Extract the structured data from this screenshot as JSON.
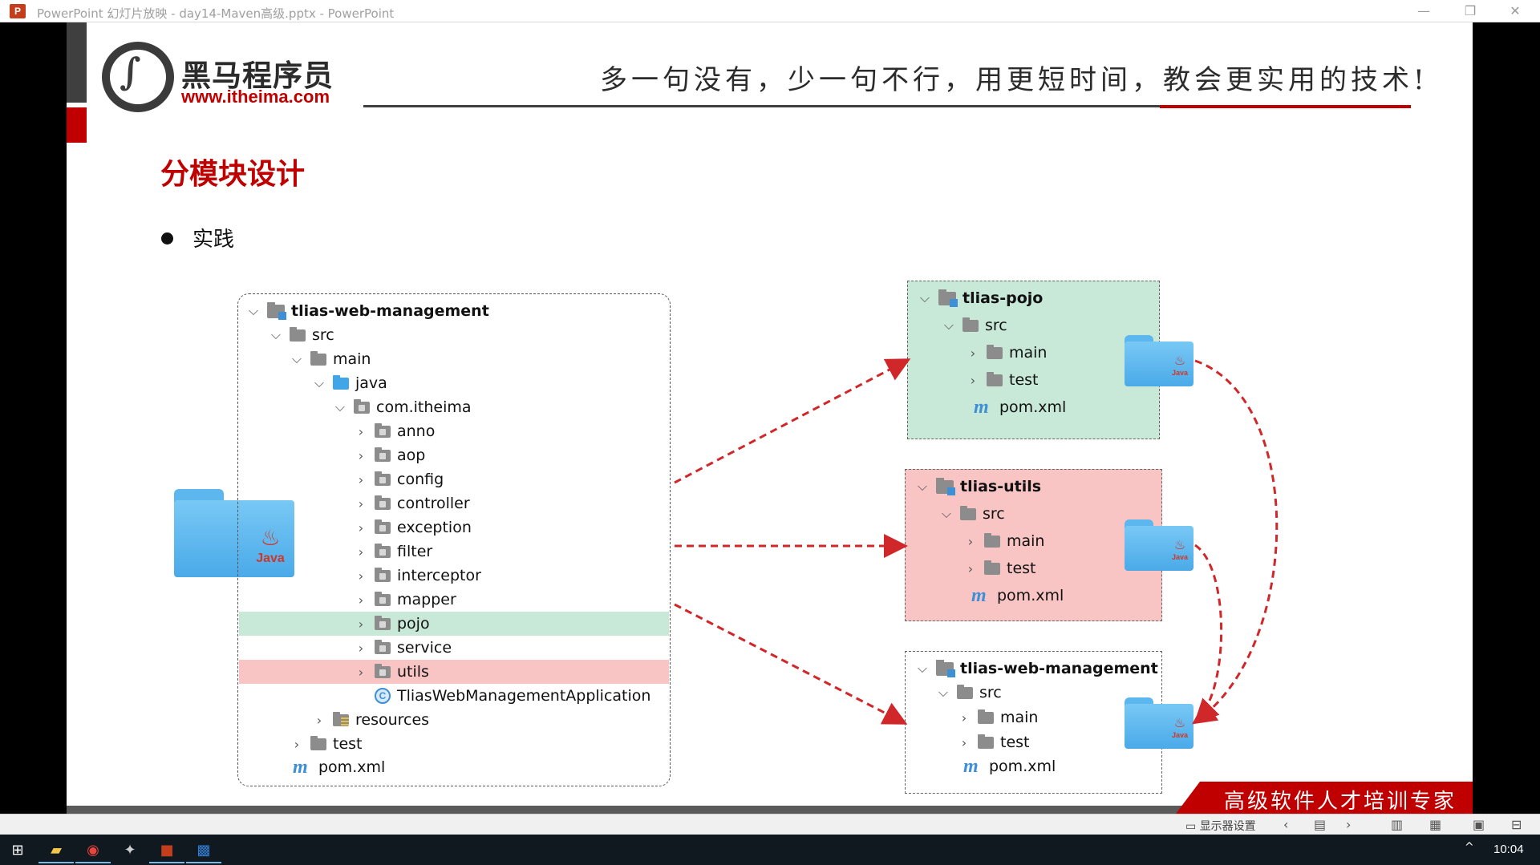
{
  "window": {
    "title": "PowerPoint 幻灯片放映  -  day14-Maven高级.pptx  -  PowerPoint",
    "app_logo": "P",
    "minimize": "—",
    "restore": "❐",
    "close": "✕"
  },
  "slide": {
    "brand_name": "黑马程序员",
    "brand_url": "www.itheima.com",
    "slogan": "多一句没有，少一句不行，用更短时间，教会更实用的技术!",
    "heading": "分模块设计",
    "bullet": "实践",
    "java_folder_label": "Java",
    "banner_text": "高级软件人才培训专家"
  },
  "main_tree": {
    "root": "tlias-web-management",
    "src": "src",
    "main": "main",
    "java": "java",
    "package": "com.itheima",
    "packages": [
      "anno",
      "aop",
      "config",
      "controller",
      "exception",
      "filter",
      "interceptor",
      "mapper",
      "pojo",
      "service",
      "utils"
    ],
    "app_class": "TliasWebManagementApplication",
    "class_icon": "C",
    "resources": "resources",
    "test": "test",
    "pom": "pom.xml",
    "maven_icon": "m"
  },
  "modules": [
    {
      "name": "tlias-pojo",
      "src": "src",
      "main": "main",
      "test": "test",
      "pom": "pom.xml",
      "bg": "#c8e8d8"
    },
    {
      "name": "tlias-utils",
      "src": "src",
      "main": "main",
      "test": "test",
      "pom": "pom.xml",
      "bg": "#f8c4c4"
    },
    {
      "name": "tlias-web-management",
      "src": "src",
      "main": "main",
      "test": "test",
      "pom": "pom.xml",
      "bg": "#ffffff"
    }
  ],
  "colors": {
    "accent_red": "#c00000",
    "arrow_red": "#d0272a",
    "java_blue": "#4aaae8",
    "highlight_green": "#c8e8d8",
    "highlight_red": "#f8c4c4"
  },
  "statusbar": {
    "monitor_settings": "显示器设置",
    "prev": "‹",
    "next": "›"
  },
  "taskbar": {
    "clock": "10:04",
    "tray_up": "^"
  }
}
